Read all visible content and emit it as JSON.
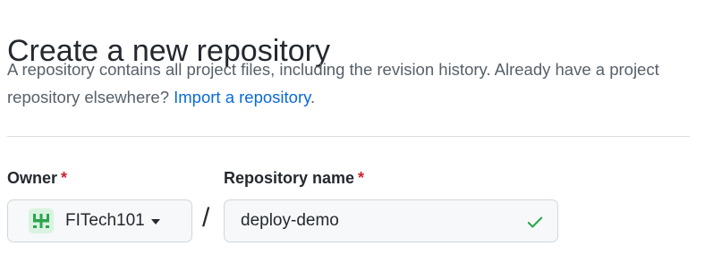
{
  "header": {
    "title": "Create a new repository",
    "description": "A repository contains all project files, including the revision history. Already have a project repository elsewhere?",
    "import_link": "Import a repository",
    "description_end": "."
  },
  "owner": {
    "label": "Owner",
    "required_mark": "*",
    "selected": "FITech101",
    "avatar_icon": "identicon",
    "avatar_color": "#2da44e"
  },
  "separator": "/",
  "repository": {
    "label": "Repository name",
    "required_mark": "*",
    "value": "deploy-demo",
    "status_icon": "check-icon",
    "status_color": "#2da44e"
  },
  "colors": {
    "link": "#0969da",
    "required": "#cf222e",
    "success": "#2da44e"
  }
}
